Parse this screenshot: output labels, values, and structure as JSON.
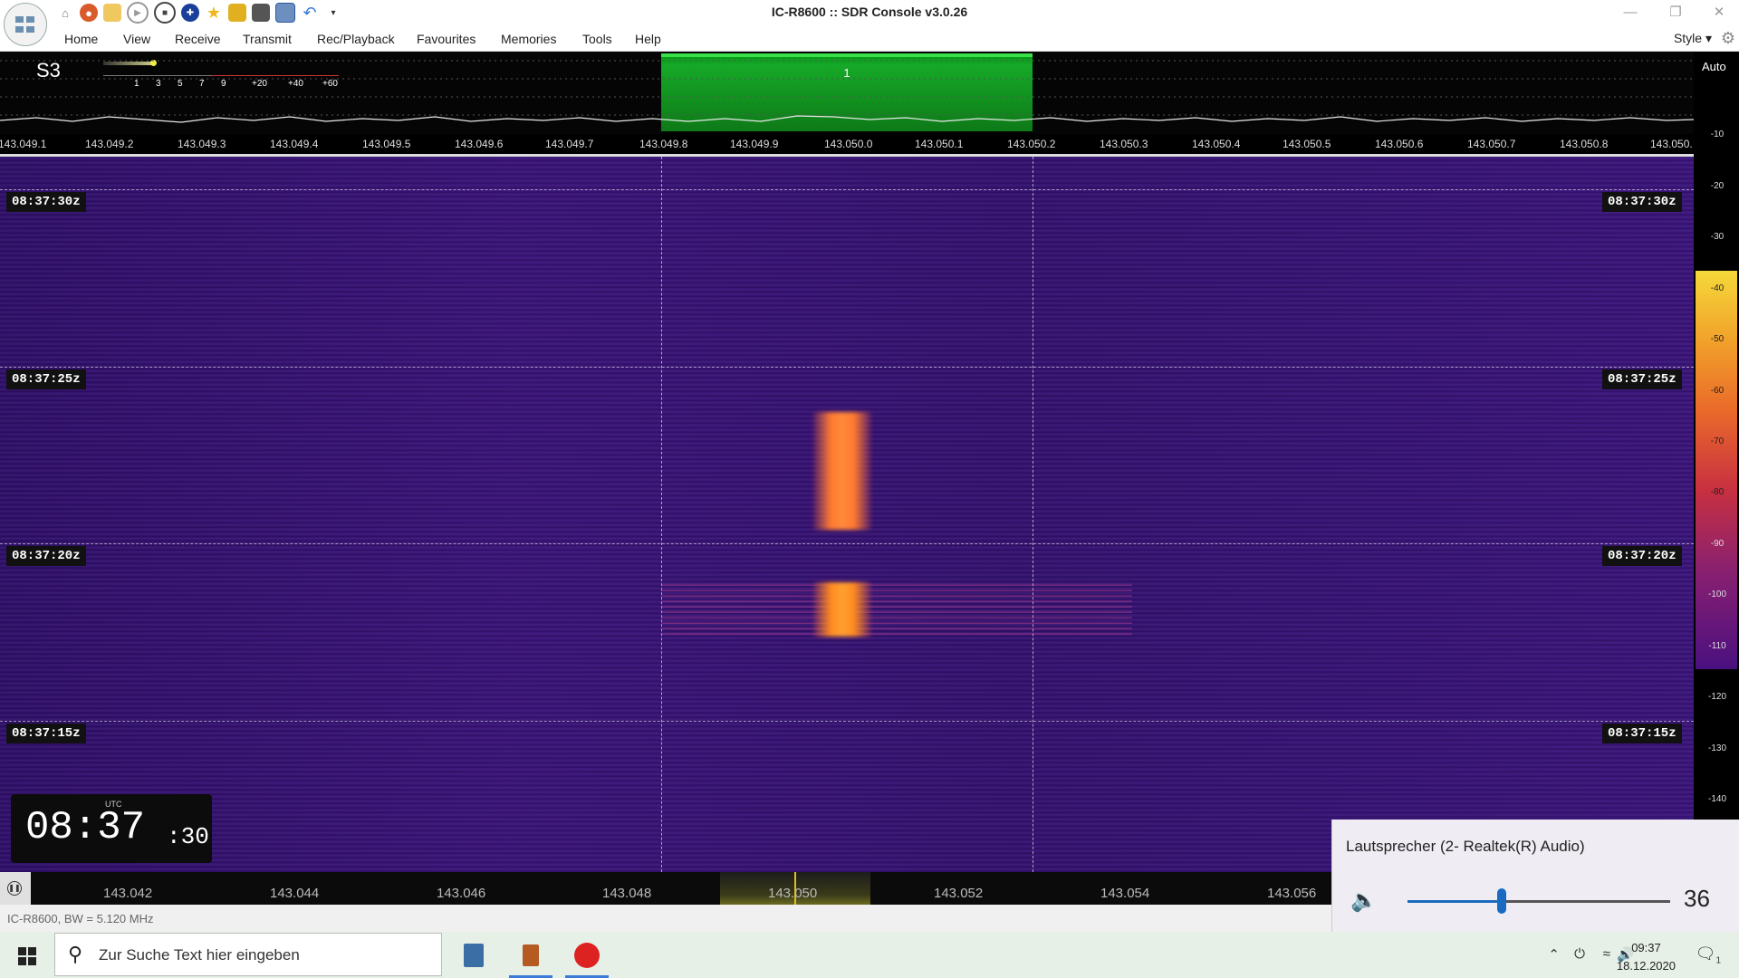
{
  "window": {
    "title": "IC-R8600 :: SDR Console v3.0.26"
  },
  "menu": {
    "items": [
      "Home",
      "View",
      "Receive",
      "Transmit",
      "Rec/Playback",
      "Favourites",
      "Memories",
      "Tools",
      "Help"
    ],
    "style_label": "Style"
  },
  "meter": {
    "s_value": "S3",
    "scale": [
      "1",
      "3",
      "5",
      "7",
      "9",
      "+20",
      "+40",
      "+60"
    ]
  },
  "filter": {
    "label": "1"
  },
  "top_frequencies": [
    "143.049.1",
    "143.049.2",
    "143.049.3",
    "143.049.4",
    "143.049.5",
    "143.049.6",
    "143.049.7",
    "143.049.8",
    "143.049.9",
    "143.050.0",
    "143.050.1",
    "143.050.2",
    "143.050.3",
    "143.050.4",
    "143.050.5",
    "143.050.6",
    "143.050.7",
    "143.050.8",
    "143.050."
  ],
  "waterfall": {
    "time_labels": [
      "08:37:30z",
      "08:37:25z",
      "08:37:20z",
      "08:37:15z"
    ],
    "clock": {
      "tz": "UTC",
      "hm": "08:37",
      "sec": ":30"
    }
  },
  "right_scale": {
    "auto_label": "Auto",
    "db_labels": [
      "-10",
      "-20",
      "-30",
      "-40",
      "-50",
      "-60",
      "-70",
      "-80",
      "-90",
      "-100",
      "-110",
      "-120",
      "-130",
      "-140"
    ]
  },
  "bottom_frequencies": [
    "143.042",
    "143.044",
    "143.046",
    "143.048",
    "143.050",
    "143.052",
    "143.054",
    "143.056"
  ],
  "status": {
    "text": "IC-R8600, BW = 5.120 MHz"
  },
  "volume": {
    "device": "Lautsprecher (2- Realtek(R) Audio)",
    "value": "36",
    "level": 0.36
  },
  "taskbar": {
    "search_placeholder": "Zur Suche Text hier eingeben",
    "time": "09:37",
    "date": "18.12.2020",
    "notification_count": "1"
  },
  "colors": {
    "filter_green": "#16a828",
    "waterfall_bg": "#3a1478",
    "signal": "#ff8a3a",
    "accent": "#1a6bc0"
  }
}
